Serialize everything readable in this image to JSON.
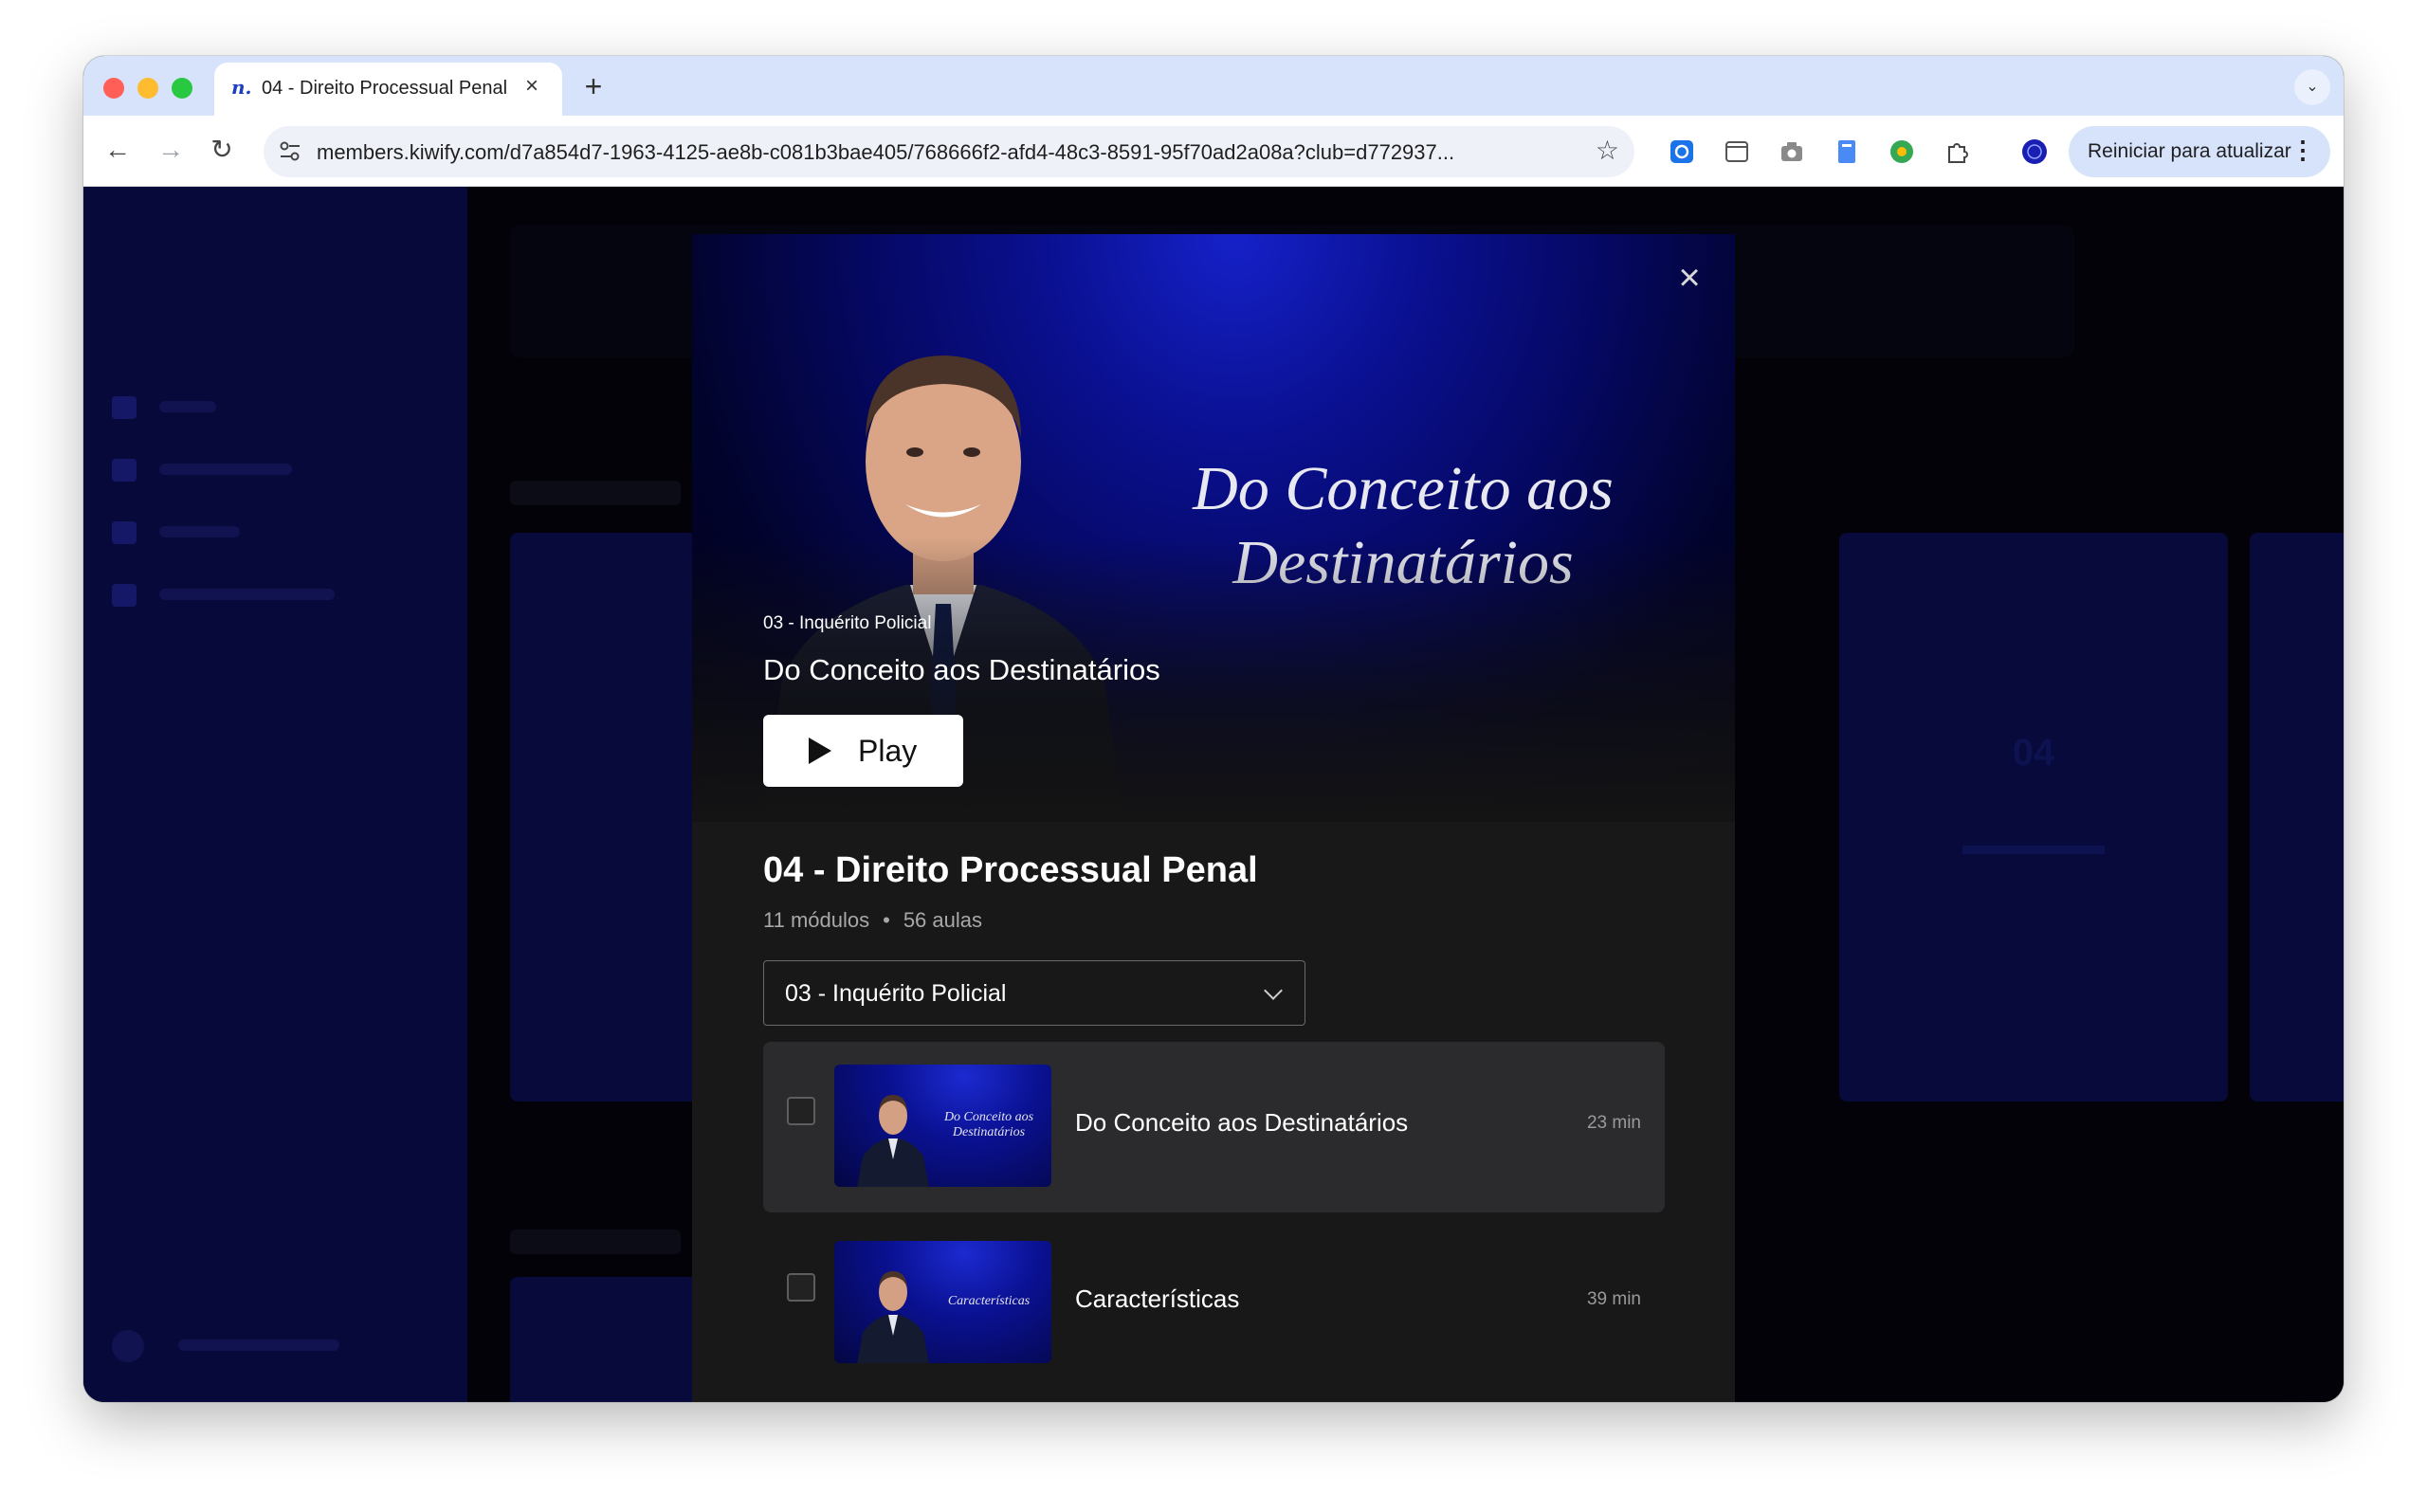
{
  "browser": {
    "tab": {
      "favicon": "n.",
      "title": "04 - Direito Processual Penal"
    },
    "url": "members.kiwify.com/d7a854d7-1963-4125-ae8b-c081b3bae405/768666f2-afd4-48c3-8591-95f70ad2a08a?club=d772937...",
    "update_button": "Reiniciar para atualizar",
    "icons": {
      "back": "arrow-left-icon",
      "forward": "arrow-right-icon",
      "reload": "reload-icon",
      "site_info": "tune-icon",
      "bookmark": "star-icon",
      "tab_close": "close-icon",
      "new_tab": "plus-icon",
      "tab_search": "chevron-down-icon",
      "extensions": "puzzle-icon",
      "menu": "kebab-menu-icon"
    }
  },
  "modal": {
    "hero": {
      "art_title": "Do Conceito aos Destinatários",
      "module": "03 - Inquérito Policial",
      "lesson": "Do Conceito aos Destinatários",
      "play_label": "Play"
    },
    "course": {
      "title": "04 - Direito Processual Penal",
      "modules": "11 módulos",
      "separator": "•",
      "lessons": "56 aulas"
    },
    "module_select": {
      "selected": "03 - Inquérito Policial"
    },
    "lessons": [
      {
        "title": "Do Conceito aos Destinatários",
        "duration": "23 min",
        "thumb_text": "Do Conceito aos Destinatários",
        "active": true
      },
      {
        "title": "Características",
        "duration": "39 min",
        "thumb_text": "Características",
        "active": false
      }
    ]
  },
  "colors": {
    "tab_bar": "#d6e3fb",
    "hero_blue": "#0a1090",
    "modal_bg": "#181818",
    "active_row": "#2b2b2d",
    "sidebar_bg": "#07093a"
  }
}
